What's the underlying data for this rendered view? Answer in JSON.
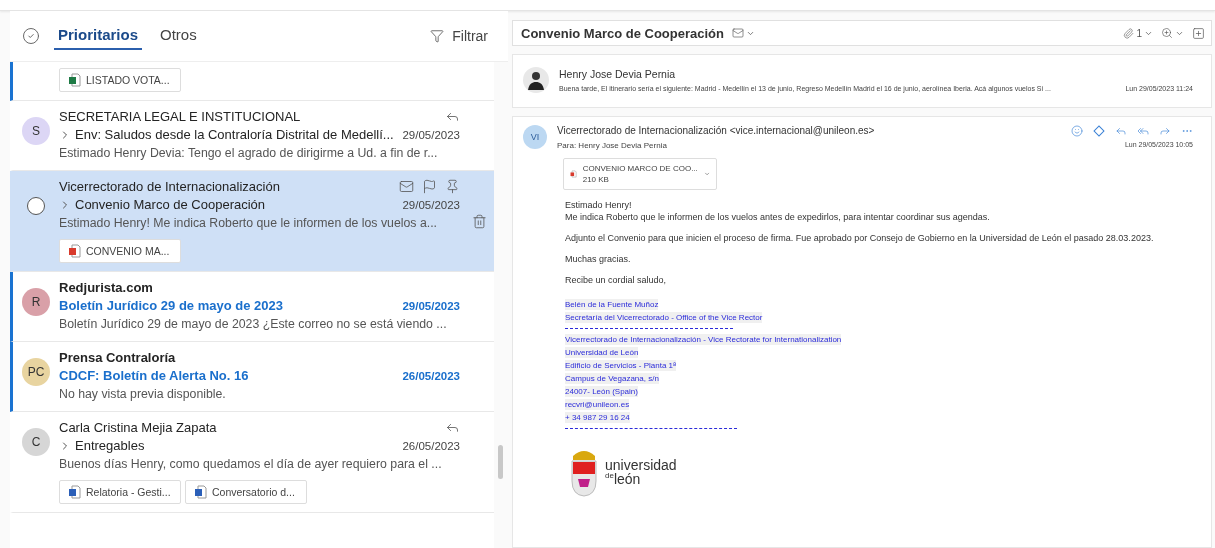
{
  "tabs": [
    {
      "label": "Prioritarios",
      "selected": true
    },
    {
      "label": "Otros",
      "selected": false
    }
  ],
  "filter": {
    "label": "Filtrar"
  },
  "partial_item": {
    "unread": true,
    "attachments": [
      {
        "kind": "excel",
        "name": "LISTADO VOTA..."
      }
    ]
  },
  "messages": [
    {
      "initials": "S",
      "color": "#dcd6f5",
      "sender": "SECRETARIA LEGAL E INSTITUCIONAL",
      "thread": true,
      "subject": "Env: Saludos desde la Contraloría Distrital de Medellí...",
      "date": "29/05/2023",
      "preview": "Estimado Henry Devia: Tengo el agrado de dirigirme a Ud. a fin de r...",
      "unread": false,
      "selected": false,
      "replied": true
    },
    {
      "sender": "Vicerrectorado de Internacionalización",
      "thread": true,
      "subject": "Convenio Marco de Cooperación",
      "date": "29/05/2023",
      "preview": "Estimado Henry! Me indica Roberto que le informen de los vuelos a...",
      "unread": false,
      "selected": true,
      "replied": false,
      "attachments": [
        {
          "kind": "pdf",
          "name": "CONVENIO MA..."
        }
      ]
    },
    {
      "initials": "R",
      "color": "#d9a0a8",
      "sender": "Redjurista.com",
      "thread": false,
      "subject": "Boletín Jurídico 29 de mayo de 2023",
      "date": "29/05/2023",
      "preview": "Boletín Jurídico 29 de mayo de 2023 ¿Este correo no se está viendo ...",
      "unread": true,
      "selected": false,
      "replied": false
    },
    {
      "initials": "PC",
      "color": "#e8d4a0",
      "sender": "Prensa Contraloría",
      "thread": false,
      "subject": "CDCF: Boletín de Alerta No. 16",
      "date": "26/05/2023",
      "preview": "No hay vista previa disponible.",
      "unread": true,
      "selected": false,
      "replied": false
    },
    {
      "initials": "C",
      "color": "#d6d6d6",
      "sender": "Carla Cristina Mejia Zapata",
      "thread": true,
      "subject": "Entregables",
      "date": "26/05/2023",
      "preview": "Buenos días Henry, como quedamos el día de ayer requiero para el ...",
      "unread": false,
      "selected": false,
      "replied": true,
      "attachments": [
        {
          "kind": "word",
          "name": "Relatoria - Gesti..."
        },
        {
          "kind": "word",
          "name": "Conversatorio d..."
        }
      ]
    }
  ],
  "reading_pane": {
    "subject": "Convenio Marco de Cooperación",
    "attachment_count": "1",
    "collapsed_message": {
      "sender": "Henry Jose Devia Pernia",
      "preview": "Buena tarde, El itinerario sería el siguiente: Madrid - Medellín el 13 de junio, Regreso Medellín Madrid el 16 de junio, aerolínea Iberia. Acá algunos vuelos Si ...",
      "date": "Lun 29/05/2023 11:24"
    },
    "message": {
      "initials": "VI",
      "sender": "Vicerrectorado de Internacionalización <vice.internacional@unileon.es>",
      "to_label": "Para:",
      "to": "Henry Jose Devia Pernia",
      "date": "Lun 29/05/2023 10:05",
      "attachment": {
        "name": "CONVENIO MARCO DE COO...",
        "size": "210 KB"
      },
      "body": [
        [
          "Estimado Henry!",
          "Me indica Roberto que le informen de los vuelos antes de expedirlos, para intentar coordinar sus agendas."
        ],
        [
          "Adjunto el Convenio para que inicien el proceso de firma. Fue aprobado por Consejo de Gobierno en la Universidad de León el pasado 28.03.2023."
        ],
        [
          "Muchas gracias."
        ],
        [
          "Recibe un cordial saludo,"
        ]
      ],
      "signature": [
        {
          "kind": "text",
          "text": "Belén de la Fuente Muñoz"
        },
        {
          "kind": "text",
          "text": "Secretaría del Vicerrectorado - Office of the Vice Rector"
        },
        {
          "kind": "rule"
        },
        {
          "kind": "text",
          "text": "Vicerrectorado de Internacionalización - Vice Rectorate for Internationalization"
        },
        {
          "kind": "text",
          "text": "Universidad de León"
        },
        {
          "kind": "text",
          "text": "Edificio de Servicios - Planta 1ª"
        },
        {
          "kind": "text",
          "text": "Campus de Vegazana, s/n"
        },
        {
          "kind": "text",
          "text": "24007- León (Spain)"
        },
        {
          "kind": "email",
          "text": "recvri@unileon.es"
        },
        {
          "kind": "text",
          "text": "+ 34 987 29 16 24"
        },
        {
          "kind": "rule"
        }
      ],
      "logo": {
        "word1": "universidad",
        "word2_small": "de",
        "word2": "león"
      }
    }
  }
}
